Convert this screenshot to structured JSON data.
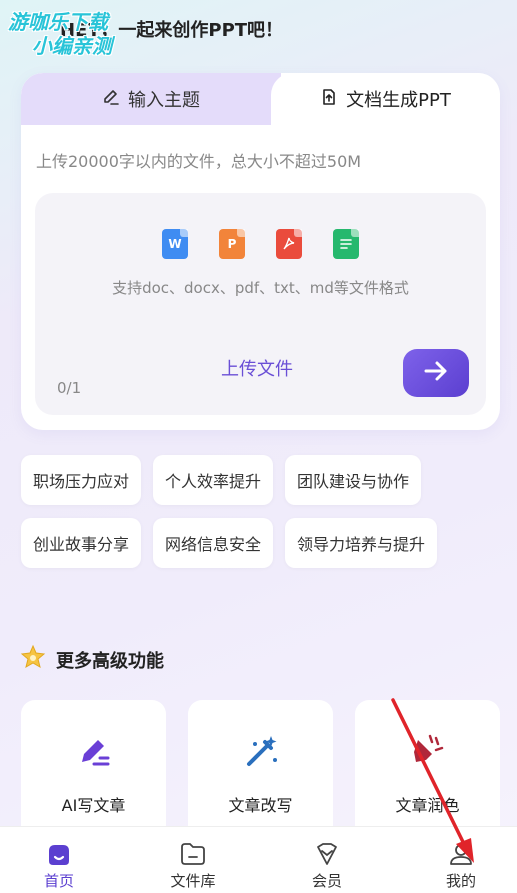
{
  "header": {
    "title": "HEY，一起来创作PPT吧！",
    "watermark_line1": "游咖乐下载",
    "watermark_line2": "小编亲测"
  },
  "tabs": [
    {
      "label": "输入主题",
      "icon": "pencil-icon",
      "active": false
    },
    {
      "label": "文档生成PPT",
      "icon": "upload-doc-icon",
      "active": true
    }
  ],
  "upload": {
    "hint": "上传20000字以内的文件，总大小不超过50M",
    "file_types": [
      "W",
      "P",
      "pdf",
      "txt"
    ],
    "formats_text": "支持doc、docx、pdf、txt、md等文件格式",
    "upload_label": "上传文件",
    "counter": "0/1"
  },
  "topics": [
    [
      "职场压力应对",
      "个人效率提升",
      "团队建设与协作"
    ],
    [
      "创业故事分享",
      "网络信息安全",
      "领导力培养与提升"
    ]
  ],
  "more": {
    "title": "更多高级功能",
    "features": [
      {
        "label": "AI写文章",
        "icon": "ai-write-icon"
      },
      {
        "label": "文章改写",
        "icon": "magic-wand-icon"
      },
      {
        "label": "文章润色",
        "icon": "sparkle-brush-icon"
      }
    ]
  },
  "nav": [
    {
      "label": "首页",
      "icon": "home-icon",
      "active": true
    },
    {
      "label": "文件库",
      "icon": "folder-icon",
      "active": false
    },
    {
      "label": "会员",
      "icon": "vip-icon",
      "active": false
    },
    {
      "label": "我的",
      "icon": "profile-icon",
      "active": false
    }
  ],
  "colors": {
    "accent": "#5b3fd0",
    "annotation_arrow": "#e0242a"
  }
}
